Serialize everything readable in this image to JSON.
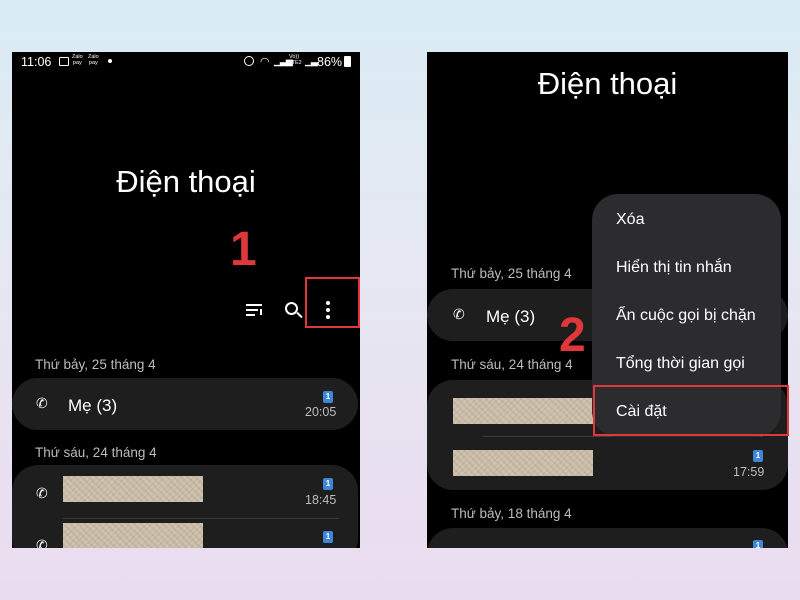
{
  "left_screen": {
    "status_bar": {
      "time": "11:06",
      "zalo_pay_1": "Zalo\npay",
      "zalo_pay_2": "Zalo\npay",
      "volte": "Vo))\nLTE2",
      "battery": "86%"
    },
    "title": "Điện thoại",
    "step_number": "1",
    "toolbar": {
      "filter_icon": "filter-icon",
      "search_icon": "search-icon",
      "more_icon": "more-options-icon"
    },
    "sections": [
      {
        "header": "Thứ bảy, 25 tháng 4",
        "items": [
          {
            "name": "Mẹ (3)",
            "time": "20:05",
            "sim": "1"
          }
        ]
      },
      {
        "header": "Thứ sáu, 24 tháng 4",
        "items": [
          {
            "name": "",
            "time": "18:45",
            "sim": "1"
          },
          {
            "name": "",
            "time": "",
            "sim": "1"
          }
        ]
      }
    ]
  },
  "right_screen": {
    "title": "Điện thoại",
    "step_number": "2",
    "sections": [
      {
        "header": "Thứ bảy, 25 tháng 4",
        "items": [
          {
            "name": "Mẹ (3)"
          }
        ]
      },
      {
        "header": "Thứ sáu, 24 tháng 4",
        "items": [
          {
            "name": "",
            "time": ""
          },
          {
            "name": "",
            "time": "17:59",
            "sim": "1"
          }
        ]
      },
      {
        "header": "Thứ bảy, 18 tháng 4",
        "items": [
          {
            "sim": "1"
          }
        ]
      }
    ],
    "menu": {
      "items": [
        {
          "label": "Xóa"
        },
        {
          "label": "Hiển thị tin nhắn"
        },
        {
          "label": "Ẩn cuộc gọi bị chặn"
        },
        {
          "label": "Tổng thời gian gọi"
        },
        {
          "label": "Cài đặt"
        }
      ]
    }
  },
  "colors": {
    "highlight": "#e0373a",
    "screen_bg": "#000000",
    "card_bg": "#1e1e1e",
    "menu_bg": "#2c2c2e",
    "sim_badge": "#3e86d8"
  }
}
